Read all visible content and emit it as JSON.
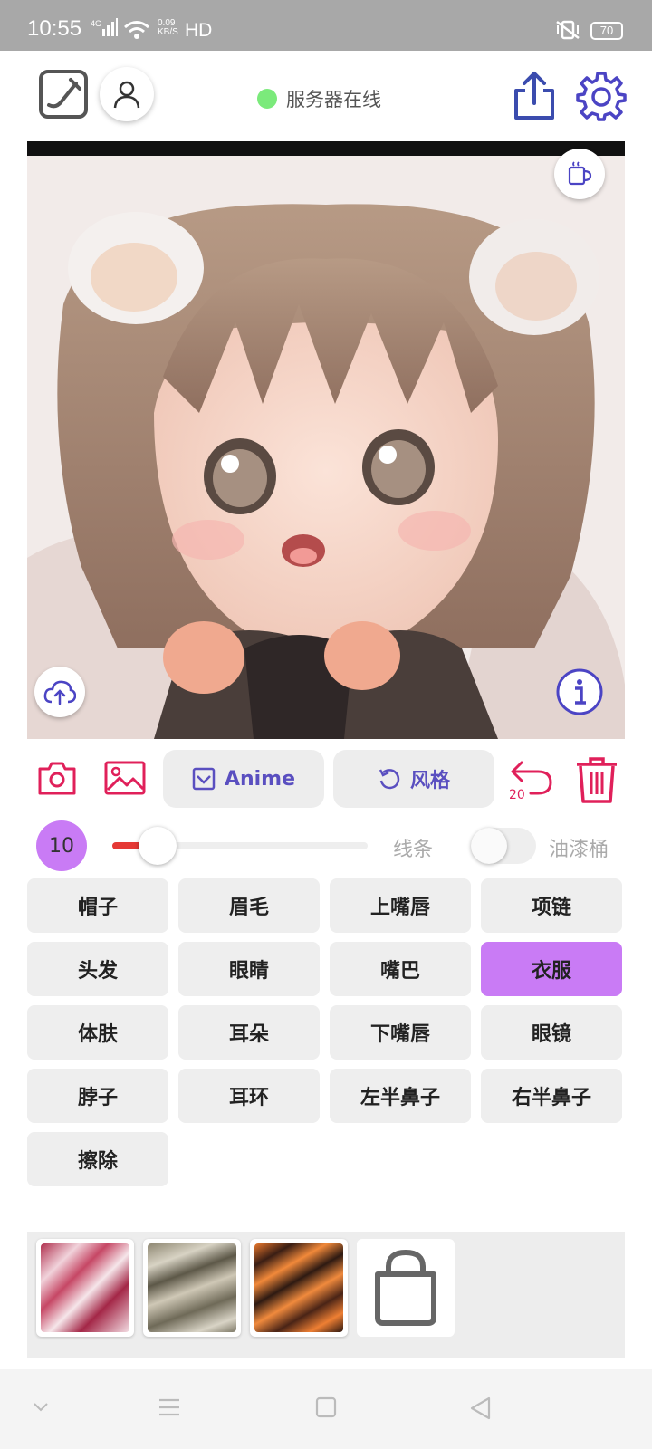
{
  "status_bar": {
    "time": "10:55",
    "network_type": "4G",
    "speed_value": "0.09",
    "speed_unit": "KB/S",
    "hd": "HD",
    "battery": "70"
  },
  "header": {
    "server_status": "服务器在线",
    "server_status_color": "#7bea7b"
  },
  "toolbar": {
    "anime_label": "Anime",
    "style_label": "风格",
    "undo_count": "20"
  },
  "brush": {
    "size": "10",
    "size_fraction": 0.12,
    "line_label": "线条",
    "bucket_label": "油漆桶",
    "bucket_enabled": false
  },
  "parts": [
    {
      "label": "帽子",
      "active": false
    },
    {
      "label": "眉毛",
      "active": false
    },
    {
      "label": "上嘴唇",
      "active": false
    },
    {
      "label": "项链",
      "active": false
    },
    {
      "label": "头发",
      "active": false
    },
    {
      "label": "眼睛",
      "active": false
    },
    {
      "label": "嘴巴",
      "active": false
    },
    {
      "label": "衣服",
      "active": true
    },
    {
      "label": "体肤",
      "active": false
    },
    {
      "label": "耳朵",
      "active": false
    },
    {
      "label": "下嘴唇",
      "active": false
    },
    {
      "label": "眼镜",
      "active": false
    },
    {
      "label": "脖子",
      "active": false
    },
    {
      "label": "耳环",
      "active": false
    },
    {
      "label": "左半鼻子",
      "active": false
    },
    {
      "label": "右半鼻子",
      "active": false
    },
    {
      "label": "擦除",
      "active": false
    }
  ],
  "colors": {
    "accent_purple": "#c97bf5",
    "icon_blue": "#4b44c4",
    "icon_red": "#e0205a"
  },
  "palette": [
    "pink-white-texture",
    "olive-gray-texture",
    "orange-tiger-texture",
    "shop-bag-icon"
  ]
}
